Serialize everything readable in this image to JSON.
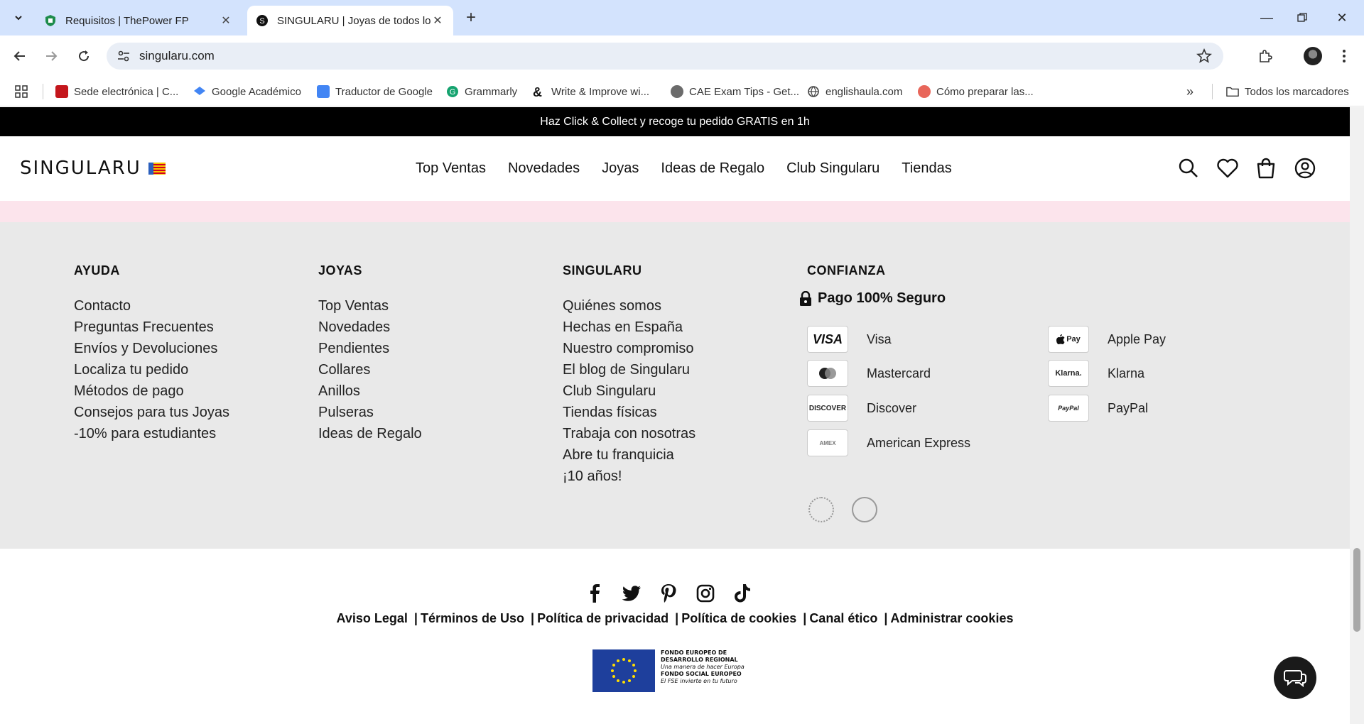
{
  "browser": {
    "tabs": [
      {
        "title": "Requisitos | ThePower FP",
        "active": false
      },
      {
        "title": "SINGULARU | Joyas de todos los",
        "active": true
      }
    ],
    "url": "singularu.com",
    "bookmarks": [
      "Sede electrónica | C...",
      "Google Académico",
      "Traductor de Google",
      "Grammarly",
      "Write & Improve wi...",
      "CAE Exam Tips - Get...",
      "englishaula.com",
      "Cómo preparar las..."
    ],
    "all_bookmarks": "Todos los marcadores",
    "overflow": "»"
  },
  "site": {
    "promo": "Haz Click & Collect y recoge tu pedido GRATIS en 1h",
    "logo": "SINGULARU",
    "nav": [
      "Top Ventas",
      "Novedades",
      "Joyas",
      "Ideas de Regalo",
      "Club Singularu",
      "Tiendas"
    ]
  },
  "footer": {
    "columns": [
      {
        "title": "AYUDA",
        "items": [
          "Contacto",
          "Preguntas Frecuentes",
          "Envíos y Devoluciones",
          "Localiza tu pedido",
          "Métodos de pago",
          "Consejos para tus Joyas",
          "-10% para estudiantes"
        ]
      },
      {
        "title": "JOYAS",
        "items": [
          "Top Ventas",
          "Novedades",
          "Pendientes",
          "Collares",
          "Anillos",
          "Pulseras",
          "Ideas de Regalo"
        ]
      },
      {
        "title": "SINGULARU",
        "items": [
          "Quiénes somos",
          "Hechas en España",
          "Nuestro compromiso",
          "El blog de Singularu",
          "Club Singularu",
          "Tiendas físicas",
          "Trabaja con nosotras",
          "Abre tu franquicia",
          "¡10 años!"
        ]
      }
    ],
    "trust": {
      "title": "CONFIANZA",
      "secure": "Pago 100% Seguro",
      "payments_left": [
        {
          "card": "VISA",
          "label": "Visa"
        },
        {
          "card": "MC",
          "label": "Mastercard"
        },
        {
          "card": "DISCOVER",
          "label": "Discover"
        },
        {
          "card": "AMEX",
          "label": "American Express"
        }
      ],
      "payments_right": [
        {
          "card": "Pay",
          "label": "Apple Pay"
        },
        {
          "card": "Klarna.",
          "label": "Klarna"
        },
        {
          "card": "PayPal",
          "label": "PayPal"
        }
      ]
    },
    "legal": [
      "Aviso Legal",
      "Términos de Uso",
      "Política de privacidad",
      "Política de cookies",
      "Canal ético",
      "Administrar cookies"
    ],
    "eu": {
      "line1": "FONDO EUROPEO DE",
      "line2": "DESARROLLO REGIONAL",
      "line3": "Una manera de hacer Europa",
      "line4": "FONDO SOCIAL EUROPEO",
      "line5": "El FSE invierte en tu futuro"
    }
  },
  "colors": {
    "tabbar": "#d3e3fd",
    "promo_bg": "#000000",
    "pink_band": "#fce4ec",
    "footer_bg": "#e9e9e9"
  }
}
